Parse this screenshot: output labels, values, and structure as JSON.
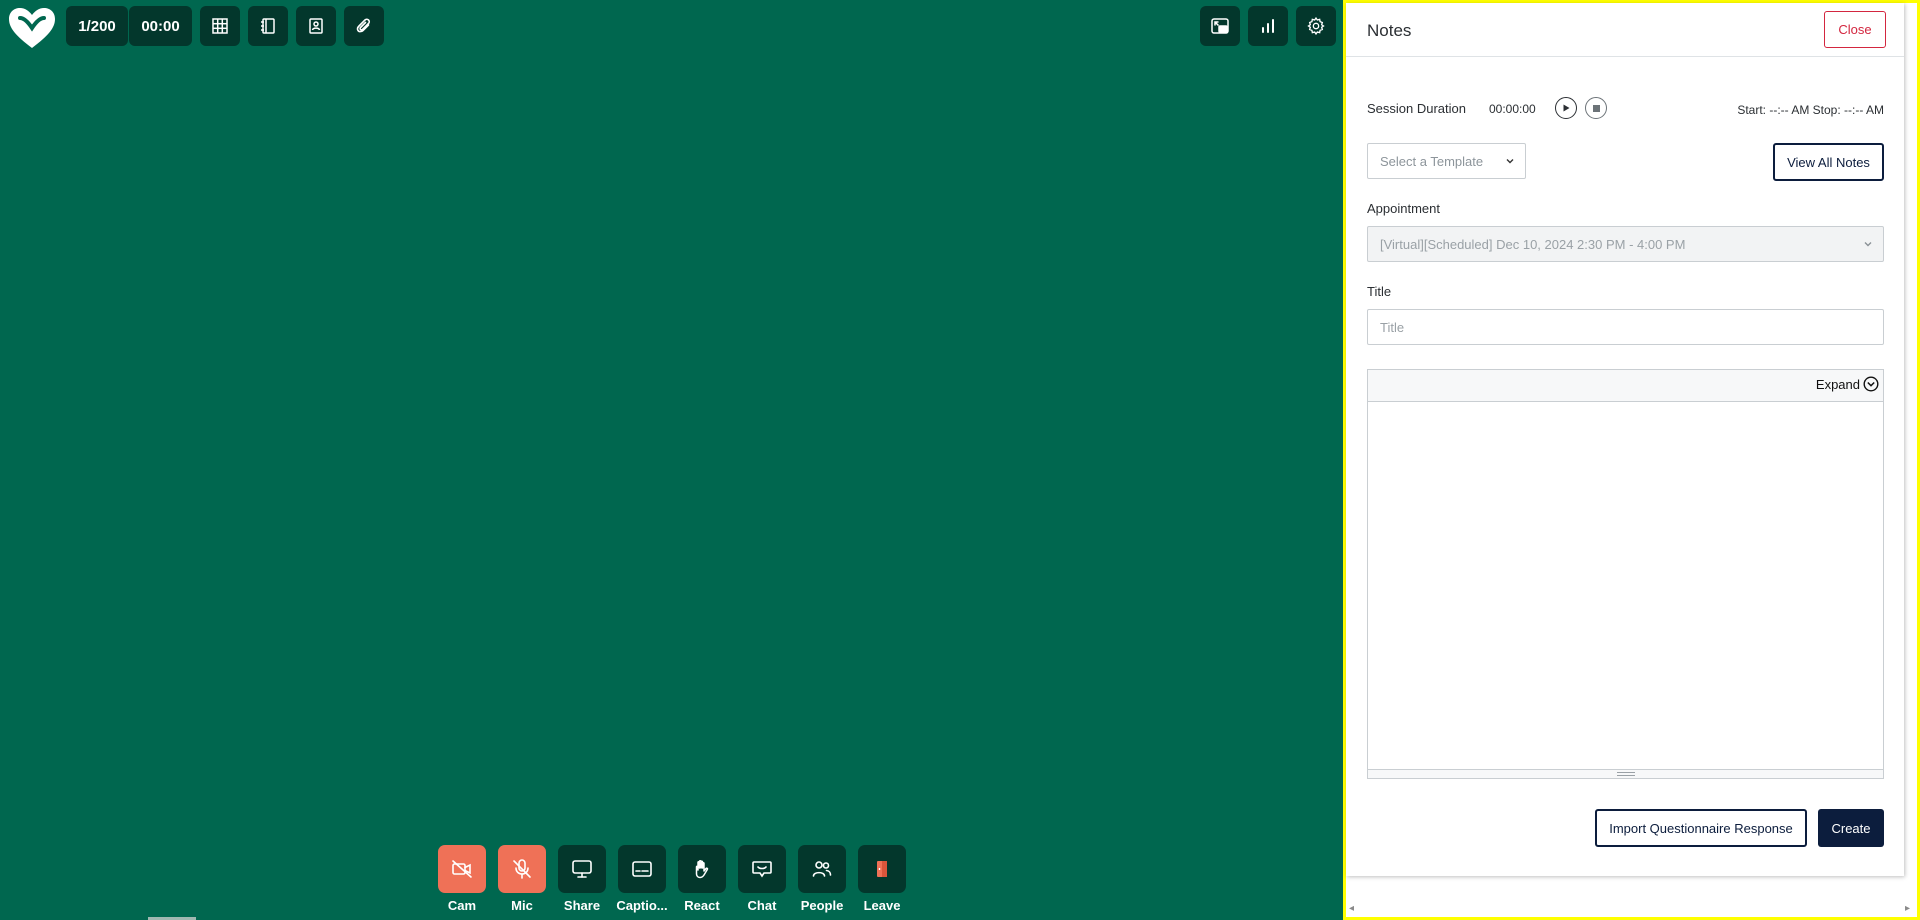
{
  "topbar": {
    "participants": "1/200",
    "timer": "00:00",
    "left_icons": [
      "grid-icon",
      "notebook-icon",
      "contact-card-icon",
      "paperclip-icon"
    ],
    "right_icons": [
      "picture-in-picture-icon",
      "stats-icon",
      "gear-icon"
    ]
  },
  "controls": [
    {
      "label": "Cam",
      "icon": "camera-off-icon",
      "state": "off"
    },
    {
      "label": "Mic",
      "icon": "mic-off-icon",
      "state": "off"
    },
    {
      "label": "Share",
      "icon": "screen-share-icon",
      "state": "on"
    },
    {
      "label": "Captio...",
      "icon": "captions-icon",
      "state": "on"
    },
    {
      "label": "React",
      "icon": "raise-hand-icon",
      "state": "on"
    },
    {
      "label": "Chat",
      "icon": "chat-icon",
      "state": "on"
    },
    {
      "label": "People",
      "icon": "people-icon",
      "state": "on"
    },
    {
      "label": "Leave",
      "icon": "exit-door-icon",
      "state": "on"
    }
  ],
  "notes": {
    "title": "Notes",
    "close_label": "Close",
    "session_label": "Session Duration",
    "session_time": "00:00:00",
    "start_stop": "Start: --:-- AM Stop: --:-- AM",
    "template_placeholder": "Select a Template",
    "view_all_label": "View All Notes",
    "appointment_label": "Appointment",
    "appointment_value": "[Virtual][Scheduled] Dec 10, 2024 2:30 PM - 4:00 PM",
    "title_label": "Title",
    "title_placeholder": "Title",
    "expand_label": "Expand",
    "import_label": "Import Questionnaire Response",
    "create_label": "Create"
  },
  "colors": {
    "stage": "#00674f",
    "tile": "#03372c",
    "off_control": "#ef7157",
    "panel_border": "#ffff00",
    "primary": "#0c1d3d",
    "close": "#d3263f"
  }
}
